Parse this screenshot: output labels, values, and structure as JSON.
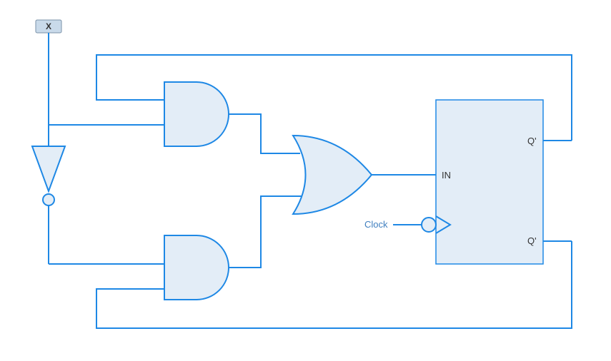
{
  "input": {
    "x_label": "X"
  },
  "clock": {
    "label": "Clock"
  },
  "flipflop": {
    "in_label": "IN",
    "q_label": "Q'",
    "qbar_label": "Q'"
  },
  "colors": {
    "wire": "#1e88e5",
    "fill": "#e3edf7",
    "input_fill": "#c9daea"
  }
}
